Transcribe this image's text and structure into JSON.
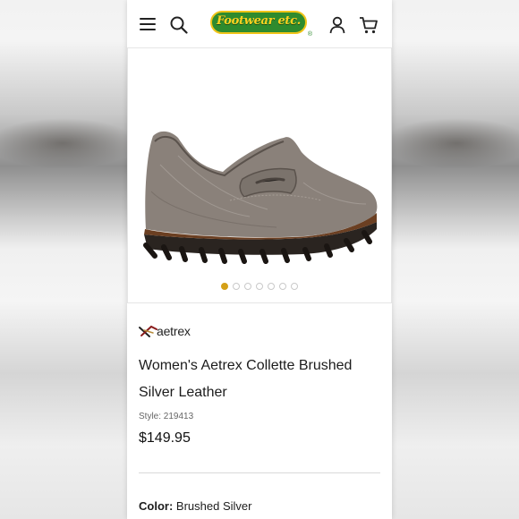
{
  "header": {
    "logo_text": "Footwear etc.",
    "logo_mark": "®",
    "icons": [
      "menu-icon",
      "search-icon",
      "account-icon",
      "cart-icon"
    ]
  },
  "gallery": {
    "image": "shoe-icon",
    "slide_count": 7,
    "active_slide": 1
  },
  "product": {
    "brand": "aetrex",
    "title": "Women's Aetrex Collette Brushed Silver Leather",
    "style_label": "Style:",
    "style_number": "219413",
    "price": "$149.95",
    "color_label": "Color:",
    "color_value": "Brushed Silver"
  },
  "colors": {
    "logo_green": "#2e8b2e",
    "logo_yellow": "#ffd21f",
    "active_dot": "#d4a017"
  }
}
